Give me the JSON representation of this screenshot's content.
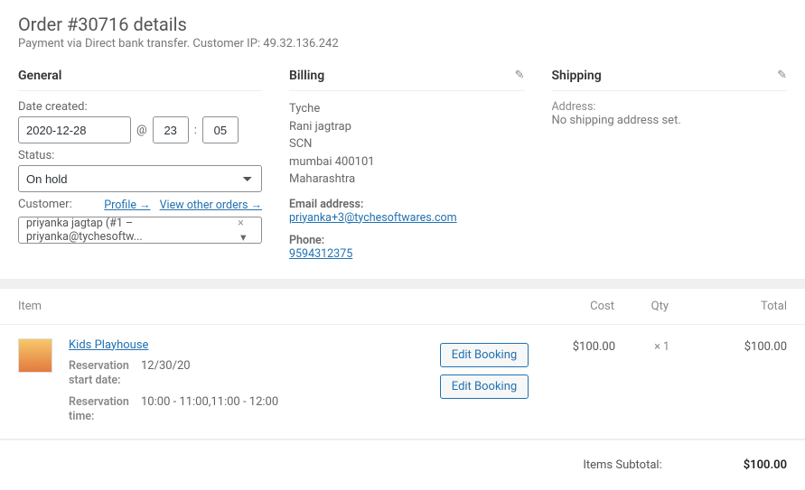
{
  "order": {
    "title": "Order #30716 details",
    "payment_line": "Payment via Direct bank transfer. Customer IP: 49.32.136.242"
  },
  "general": {
    "heading": "General",
    "date_label": "Date created:",
    "date": "2020-12-28",
    "at": "@",
    "colon": ":",
    "hour": "23",
    "minute": "05",
    "status_label": "Status:",
    "status": "On hold",
    "customer_label": "Customer:",
    "profile_link": "Profile →",
    "other_orders_link": "View other orders →",
    "customer_value": "priyanka jagtap (#1 – priyanka@tychesoftw..."
  },
  "billing": {
    "heading": "Billing",
    "line1": "Tyche",
    "line2": "Rani jagtrap",
    "line3": "SCN",
    "line4": "mumbai 400101",
    "line5": "Maharashtra",
    "email_label": "Email address:",
    "email": "priyanka+3@tychesoftwares.com",
    "phone_label": "Phone:",
    "phone": "9594312375"
  },
  "shipping": {
    "heading": "Shipping",
    "addr_label": "Address:",
    "none": "No shipping address set."
  },
  "items": {
    "head_item": "Item",
    "head_cost": "Cost",
    "head_qty": "Qty",
    "head_total": "Total",
    "rows": [
      {
        "name": "Kids Playhouse",
        "start_lbl": "Reservation start date:",
        "start_val": "12/30/20",
        "time_lbl": "Reservation time:",
        "time_val": "10:00 - 11:00,11:00 - 12:00",
        "edit1": "Edit Booking",
        "edit2": "Edit Booking",
        "cost": "$100.00",
        "qty": "× 1",
        "total": "$100.00"
      }
    ],
    "subtotal_label": "Items Subtotal:",
    "subtotal_value": "$100.00"
  }
}
